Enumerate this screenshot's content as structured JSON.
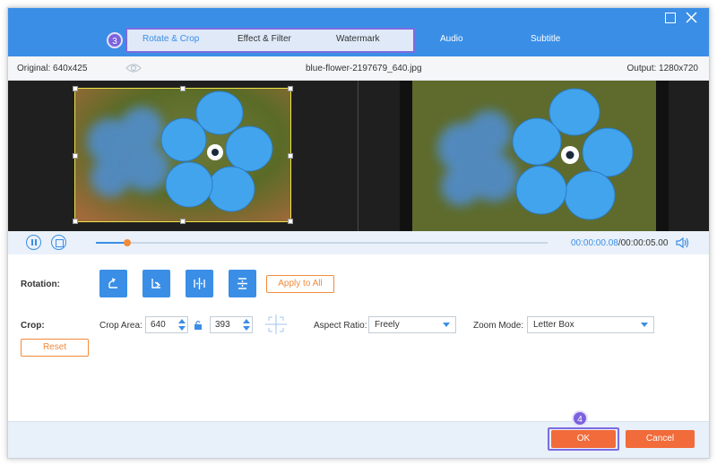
{
  "tabs": [
    {
      "label": "Rotate & Crop",
      "active": true
    },
    {
      "label": "Effect & Filter",
      "active": false
    },
    {
      "label": "Watermark",
      "active": false
    },
    {
      "label": "Audio",
      "active": false
    },
    {
      "label": "Subtitle",
      "active": false
    }
  ],
  "badges": {
    "step_tabs": "3",
    "step_ok": "4"
  },
  "info": {
    "original": "Original: 640x425",
    "filename": "blue-flower-2197679_640.jpg",
    "output": "Output: 1280x720"
  },
  "playback": {
    "progress": 0.07,
    "current_time": "00:00:00.08",
    "total_time": "/00:00:05.00"
  },
  "rotation": {
    "label": "Rotation:",
    "buttons": [
      "rotate-left-icon",
      "rotate-right-icon",
      "flip-horizontal-icon",
      "flip-vertical-icon"
    ],
    "apply_all": "Apply to All"
  },
  "crop": {
    "label": "Crop:",
    "area_label": "Crop Area:",
    "width": "640",
    "height": "393",
    "aspect_label": "Aspect Ratio:",
    "aspect_value": "Freely",
    "zoom_label": "Zoom Mode:",
    "zoom_value": "Letter Box",
    "reset": "Reset"
  },
  "footer": {
    "ok": "OK",
    "cancel": "Cancel"
  },
  "colors": {
    "accent": "#3a8ee6",
    "orange": "#f26b3a",
    "highlight": "#7d6be0"
  }
}
